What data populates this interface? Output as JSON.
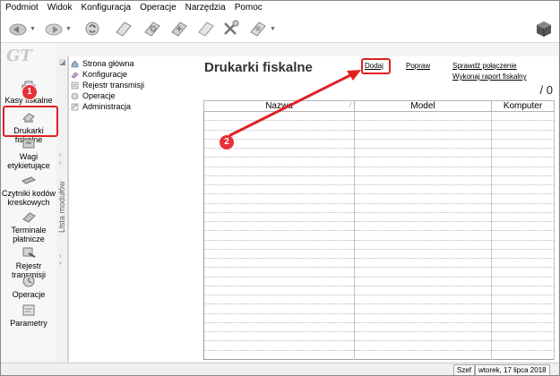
{
  "menu": [
    "Podmiot",
    "Widok",
    "Konfiguracja",
    "Operacje",
    "Narzędzia",
    "Pomoc"
  ],
  "toolbar": {
    "icons": [
      "back-icon",
      "forward-icon",
      "refresh-icon",
      "document-icon",
      "edit-icon",
      "sync-icon",
      "print-icon",
      "tools-icon",
      "help-icon",
      "cube-icon"
    ]
  },
  "sidebar": {
    "logo": "GT",
    "modules": [
      {
        "label": "Kasy fiskalne",
        "icon": "cash-register-icon"
      },
      {
        "label": "Drukarki fiskalne",
        "icon": "fiscal-printer-icon"
      },
      {
        "label": "Wagi etykietujące",
        "icon": "scale-icon"
      },
      {
        "label": "Czytniki kodów kreskowych",
        "icon": "barcode-reader-icon"
      },
      {
        "label": "Terminale płatnicze",
        "icon": "payment-terminal-icon"
      },
      {
        "label": "Rejestr transmisji",
        "icon": "transmission-icon"
      },
      {
        "label": "Operacje",
        "icon": "operations-icon"
      },
      {
        "label": "Parametry",
        "icon": "parameters-icon"
      }
    ],
    "modules_list_label": "Lista modułów"
  },
  "navtree": {
    "items": [
      {
        "label": "Strona główna",
        "icon": "home-icon"
      },
      {
        "label": "Konfiguracje",
        "icon": "config-icon"
      },
      {
        "label": "Rejestr transmisji",
        "icon": "register-icon"
      },
      {
        "label": "Operacje",
        "icon": "operations-icon"
      },
      {
        "label": "Administracja",
        "icon": "admin-icon"
      }
    ]
  },
  "main": {
    "title": "Drukarki fiskalne",
    "actions": {
      "add": "Dodaj",
      "fix": "Popraw",
      "check_connection": "Sprawdź połączenie",
      "fiscal_report": "Wykonaj raport fiskalny"
    },
    "count": "/ 0",
    "columns": [
      "Nazwa",
      "Model",
      "Komputer"
    ],
    "empty_rows": 27
  },
  "status": {
    "user": "Szef",
    "date": "wtorek, 17 lipca 2018"
  },
  "annotations": {
    "step1": "1",
    "step2": "2",
    "color": "#e02020"
  }
}
